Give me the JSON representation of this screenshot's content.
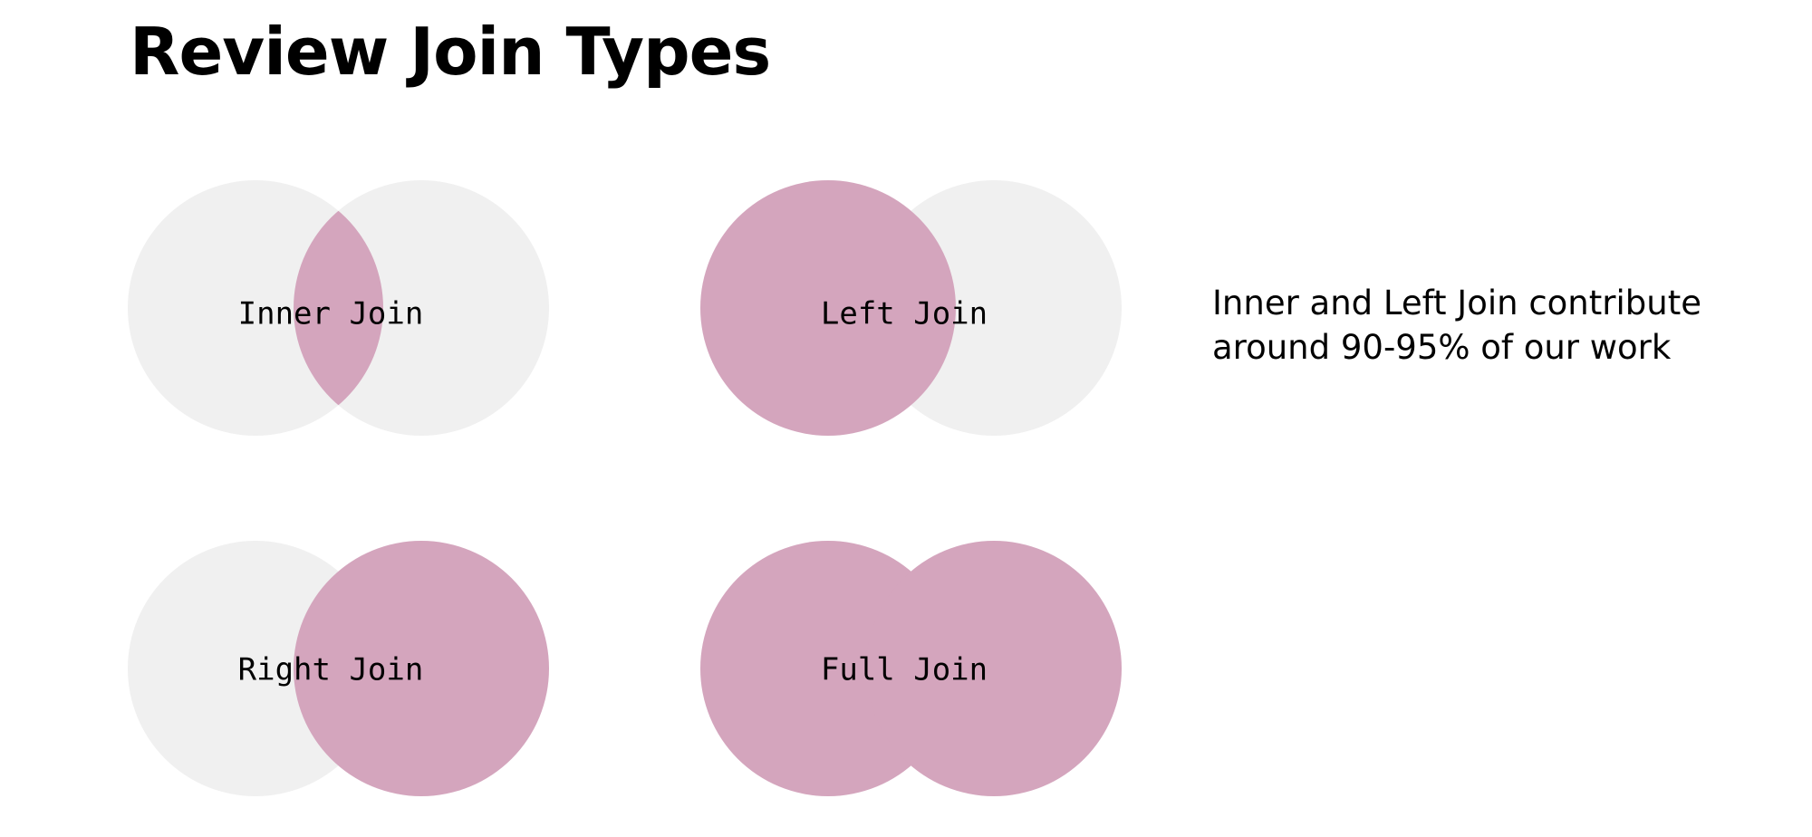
{
  "title": "Review Join Types",
  "colors": {
    "circle_inactive": "#f0f0f0",
    "circle_active": "#d4a5bd",
    "text": "#000000",
    "background": "#ffffff"
  },
  "joins": [
    {
      "label": "Inner Join",
      "type": "inner"
    },
    {
      "label": "Left Join",
      "type": "left"
    },
    {
      "label": "Right Join",
      "type": "right"
    },
    {
      "label": "Full Join",
      "type": "full"
    }
  ],
  "note": "Inner and Left Join contribute around 90-95% of our work"
}
